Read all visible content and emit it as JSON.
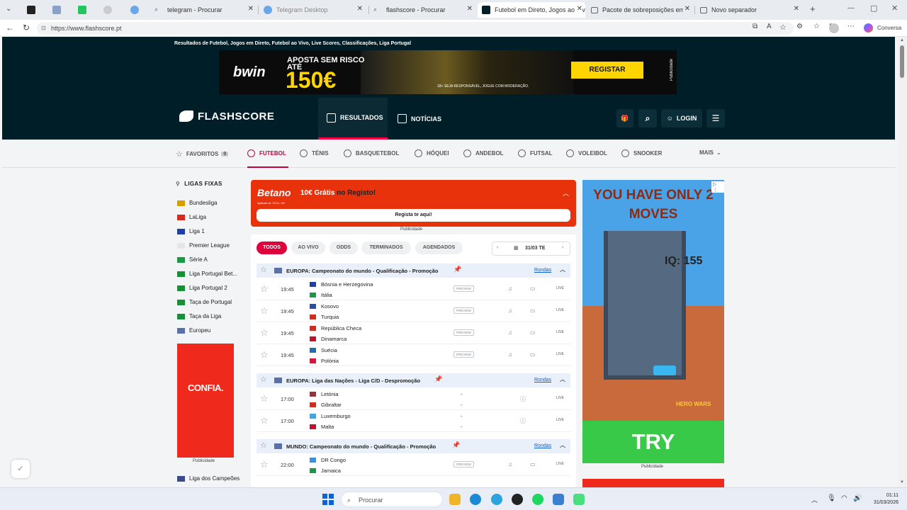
{
  "browser": {
    "tabs": [
      {
        "title": ""
      },
      {
        "title": ""
      },
      {
        "title": ""
      },
      {
        "title": ""
      },
      {
        "title": ""
      },
      {
        "title": "telegram - Procurar"
      },
      {
        "title": "Telegram Desktop"
      },
      {
        "title": "flashscore - Procurar"
      },
      {
        "title": "Futebol em Direto, Jogos ao Vivo"
      },
      {
        "title": "Pacote de sobreposições em pre"
      },
      {
        "title": "Novo separador"
      }
    ],
    "url": "https://www.flashscore.pt",
    "profile_label": "Conversa"
  },
  "site": {
    "tagline": "Resultados de Futebol, Jogos em Direto, Futebol ao Vivo, Live Scores, Classificações, Liga Portugal",
    "banner": {
      "brand": "bwin",
      "line1": "APOSTA SEM RISCO",
      "line1b": "ATÉ",
      "amount": "150€",
      "cta": "REGISTAR",
      "footer": "18+ SEJA RESPONSÁVEL, JOGUE COM MODERAÇÃO.",
      "side": "Publicidade"
    },
    "logo": "FLASHSCORE",
    "header": {
      "results": "RESULTADOS",
      "news": "NOTÍCIAS",
      "login": "LOGIN"
    },
    "sports": [
      {
        "label": "FAVORITOS",
        "badge": "0"
      },
      {
        "label": "FUTEBOL"
      },
      {
        "label": "TÉNIS"
      },
      {
        "label": "BASQUETEBOL"
      },
      {
        "label": "HÓQUEI"
      },
      {
        "label": "ANDEBOL"
      },
      {
        "label": "FUTSAL"
      },
      {
        "label": "VOLEIBOL"
      },
      {
        "label": "SNOOKER"
      },
      {
        "label": "MAIS"
      }
    ],
    "pinned_title": "LIGAS FIXAS",
    "pinned": [
      {
        "name": "Bundesliga",
        "flag": "#d4a000"
      },
      {
        "name": "LaLiga",
        "flag": "#d52b1e"
      },
      {
        "name": "Liga 1",
        "flag": "#1f3fa6"
      },
      {
        "name": "Premier League",
        "flag": "#e6e6e6"
      },
      {
        "name": "Série A",
        "flag": "#1a9a44"
      },
      {
        "name": "Liga Portugal Bet...",
        "flag": "#1a8f3a"
      },
      {
        "name": "Liga Portugal 2",
        "flag": "#1a8f3a"
      },
      {
        "name": "Taça de Portugal",
        "flag": "#1a8f3a"
      },
      {
        "name": "Taça da Liga",
        "flag": "#1a8f3a"
      },
      {
        "name": "Europeu",
        "flag": "#5b6fa8"
      }
    ],
    "left_ad": "CONFIA.",
    "left_ad_label": "Publicidade",
    "champions": "Liga dos Campeões",
    "promo": {
      "brand": "Betano",
      "offer": "10€ Grátis",
      "offer_rest": " no Registo!",
      "tc": "Aplicam-se T&Cs. 18+",
      "button": "Regista te aqui!",
      "label": "Publicidade"
    },
    "filters": [
      "TODOS",
      "AO VIVO",
      "ODDS",
      "TERMINADOS",
      "AGENDADOS"
    ],
    "date": "31/03 TE",
    "leagues": [
      {
        "name": "EUROPA: Campeonato do mundo - Qualificação - Promoção",
        "rounds": "Rondas",
        "matches": [
          {
            "time": "19:45",
            "home": "Bósnia e Herzegovina",
            "away": "Itália",
            "hf": "#1f3fa6",
            "af": "#1a9a44",
            "preview": "PREVIEW",
            "live": "LIVE"
          },
          {
            "time": "19:45",
            "home": "Kosovo",
            "away": "Turquia",
            "hf": "#2a4ea6",
            "af": "#d52b1e",
            "preview": "PREVIEW",
            "live": "LIVE"
          },
          {
            "time": "19:45",
            "home": "República Checa",
            "away": "Dinamarca",
            "hf": "#d52b1e",
            "af": "#c8102e",
            "preview": "PREVIEW",
            "live": "LIVE"
          },
          {
            "time": "19:45",
            "home": "Suécia",
            "away": "Polónia",
            "hf": "#1f6fb5",
            "af": "#dc143c",
            "preview": "PREVIEW",
            "live": "LIVE"
          }
        ]
      },
      {
        "name": "EUROPA: Liga das Nações - Liga C/D - Despromoção",
        "rounds": "Rondas",
        "matches": [
          {
            "time": "17:00",
            "home": "Letónia",
            "away": "Gibraltar",
            "hf": "#9e3039",
            "af": "#d52b1e",
            "s1": "-",
            "s2": "-",
            "live": "LIVE"
          },
          {
            "time": "17:00",
            "home": "Luxemburgo",
            "away": "Malta",
            "hf": "#3fa6e0",
            "af": "#c8102e",
            "s1": "-",
            "s2": "-",
            "live": "LIVE"
          }
        ]
      },
      {
        "name": "MUNDO: Campeonato do mundo - Qualificação - Promoção",
        "rounds": "Rondas",
        "matches": [
          {
            "time": "22:00",
            "home": "DR Congo",
            "away": "Jamaica",
            "hf": "#3f8fe0",
            "af": "#1a9a44",
            "preview": "PREVIEW",
            "live": "LIVE"
          }
        ]
      }
    ],
    "right_ad": {
      "headline": "YOU HAVE ONLY 2 MOVES",
      "iq": "IQ: 155",
      "brand": "HERO WARS",
      "cta": "TRY",
      "label": "Publicidade"
    }
  },
  "taskbar": {
    "search": "Procurar",
    "time": "01:11",
    "date": "31/03/2026"
  }
}
